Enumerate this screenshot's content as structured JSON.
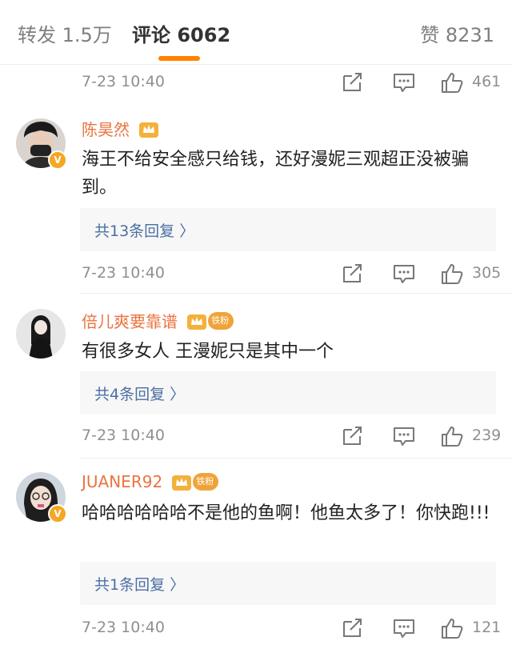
{
  "tabs": {
    "repost": "转发 1.5万",
    "comments": "评论 6062",
    "likes": "赞 8231"
  },
  "colors": {
    "accent": "#ff8200",
    "username": "#eb7340",
    "reply_link": "#4b6fa3"
  },
  "meta_rows": [
    {
      "time": "7-23 10:40",
      "likes": "461"
    },
    {
      "time": "7-23 10:40",
      "likes": "305"
    },
    {
      "time": "7-23 10:40",
      "likes": "239"
    },
    {
      "time": "7-23 10:40",
      "likes": "121"
    }
  ],
  "comments": [
    {
      "user": "陈昊然",
      "verified": true,
      "fan_badge": "",
      "text": "海王不给安全感只给钱，还好漫妮三观超正没被骗到。",
      "replies": "共13条回复 〉"
    },
    {
      "user": "倍儿爽要靠谱",
      "verified": false,
      "fan_badge": "铁粉",
      "text": "有很多女人 王漫妮只是其中一个",
      "replies": "共4条回复 〉"
    },
    {
      "user": "JUANER92",
      "verified": true,
      "fan_badge": "铁粉",
      "text": "哈哈哈哈哈哈不是他的鱼啊！他鱼太多了！你快跑!!!",
      "replies": "共1条回复 〉"
    }
  ],
  "icons": {
    "share": "share-icon",
    "reply": "comment-icon",
    "like": "thumbs-up-icon",
    "crown": "crown-badge-icon",
    "verified": "verified-v-icon"
  }
}
